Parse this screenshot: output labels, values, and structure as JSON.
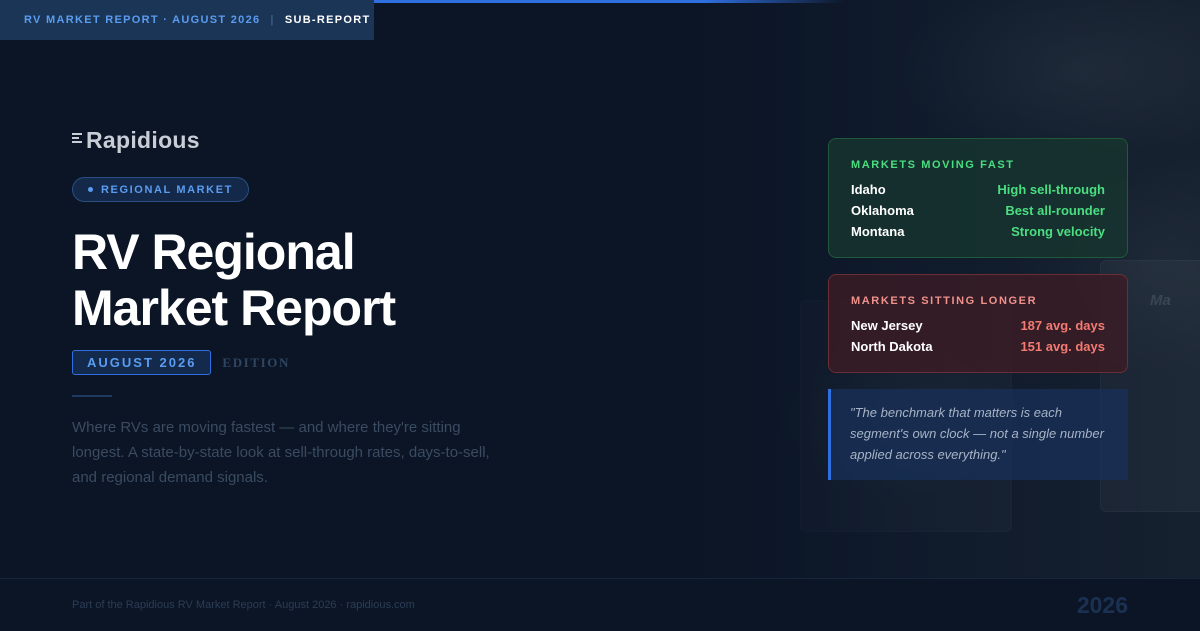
{
  "top_tag": {
    "report": "RV MARKET REPORT · AUGUST 2026",
    "separator": "|",
    "type": "SUB-REPORT"
  },
  "logo": {
    "icon": "speed-lines-icon",
    "text": "Rapidious"
  },
  "category_pill": {
    "label": "REGIONAL MARKET"
  },
  "title": {
    "line1": "RV Regional",
    "line2": "Market Report"
  },
  "edition": {
    "badge": "AUGUST 2026",
    "label": "EDITION"
  },
  "description": "Where RVs are moving fastest — and where they're sitting longest. A state-by-state look at sell-through rates, days-to-sell, and regional demand signals.",
  "markets_fast": {
    "title": "MARKETS MOVING FAST",
    "rows": [
      {
        "state": "Idaho",
        "value": "High sell-through"
      },
      {
        "state": "Oklahoma",
        "value": "Best all-rounder"
      },
      {
        "state": "Montana",
        "value": "Strong velocity"
      }
    ]
  },
  "markets_slow": {
    "title": "MARKETS SITTING LONGER",
    "rows": [
      {
        "state": "New Jersey",
        "value": "187 avg. days"
      },
      {
        "state": "North Dakota",
        "value": "151 avg. days"
      }
    ]
  },
  "quote": "\"The benchmark that matters is each segment's own clock — not a single number applied across everything.\"",
  "background_photo": {
    "vehicle_brand": "Ma"
  },
  "footer": {
    "text": "Part of the Rapidious RV Market Report · August 2026 · rapidious.com",
    "year": "2026"
  },
  "colors": {
    "background": "#0b1526",
    "accent_blue": "#2f6fe0",
    "fast_green": "#4ade80",
    "slow_red": "#f47a72"
  }
}
